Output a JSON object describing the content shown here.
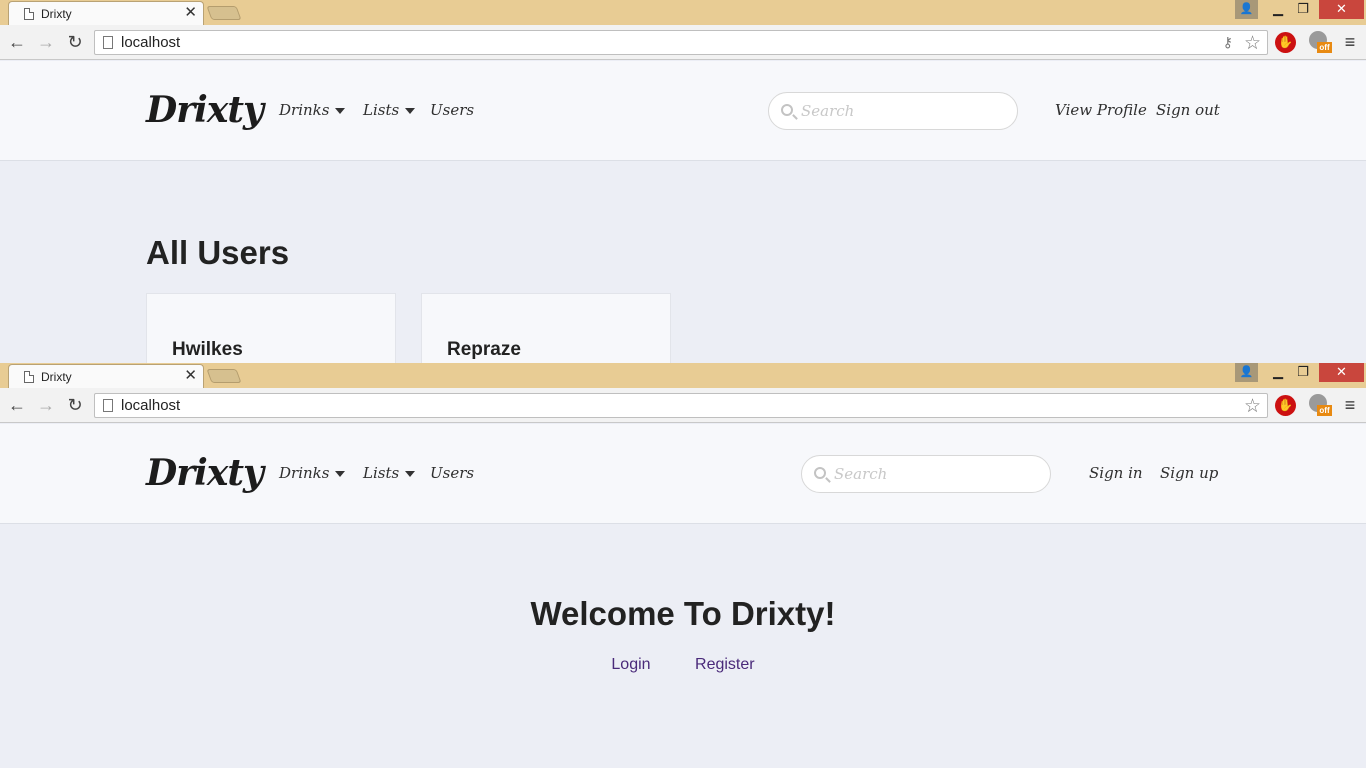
{
  "windows": [
    {
      "tab_title": "Drixty",
      "url": "localhost",
      "nav": {
        "brand": "Drixty",
        "drinks": "Drinks",
        "lists": "Lists",
        "users": "Users",
        "search_placeholder": "Search",
        "right_link_1": "View Profile",
        "right_link_2": "Sign out"
      },
      "content": {
        "title": "All Users",
        "users": [
          "Hwilkes",
          "Repraze"
        ]
      }
    },
    {
      "tab_title": "Drixty",
      "url": "localhost",
      "nav": {
        "brand": "Drixty",
        "drinks": "Drinks",
        "lists": "Lists",
        "users": "Users",
        "search_placeholder": "Search",
        "right_link_1": "Sign in",
        "right_link_2": "Sign up"
      },
      "content": {
        "welcome": "Welcome To Drixty!",
        "login": "Login",
        "register": "Register"
      }
    }
  ],
  "colors": {
    "titlebar": "#e8cc94",
    "close_button": "#c9463d",
    "link": "#4a2a7a",
    "page_bg": "#eceef5"
  },
  "icons": {
    "tab": "page-icon",
    "back": "arrow-left-icon",
    "forward": "arrow-right-icon",
    "reload": "reload-icon",
    "star": "star-icon",
    "search": "search-icon",
    "menu": "hamburger-icon"
  }
}
